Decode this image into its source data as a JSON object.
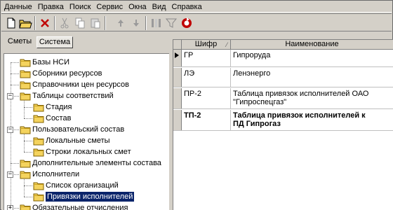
{
  "menu": [
    "Данные",
    "Правка",
    "Поиск",
    "Сервис",
    "Окна",
    "Вид",
    "Справка"
  ],
  "toolbar": {
    "buttons": [
      {
        "icon": "new-document-icon"
      },
      {
        "icon": "open-folder-icon"
      },
      {
        "icon": "delete-icon"
      },
      {
        "icon": "cut-icon"
      },
      {
        "icon": "copy-icon"
      },
      {
        "icon": "paste-icon"
      },
      {
        "icon": "move-up-icon"
      },
      {
        "icon": "move-down-icon"
      },
      {
        "icon": "columns-icon"
      },
      {
        "icon": "filter-icon"
      },
      {
        "icon": "refresh-icon"
      }
    ]
  },
  "tabs": {
    "smety": "Сметы",
    "sistema": "Система"
  },
  "tree": [
    {
      "label": "Базы НСИ",
      "level": 0,
      "expander": ""
    },
    {
      "label": "Сборники ресурсов",
      "level": 0,
      "expander": ""
    },
    {
      "label": "Справочники цен ресурсов",
      "level": 0,
      "expander": ""
    },
    {
      "label": "Таблицы соответствий",
      "level": 0,
      "expander": "−"
    },
    {
      "label": "Стадия",
      "level": 1,
      "expander": ""
    },
    {
      "label": "Состав",
      "level": 1,
      "expander": ""
    },
    {
      "label": "Пользовательский состав",
      "level": 0,
      "expander": "−"
    },
    {
      "label": "Локальные сметы",
      "level": 1,
      "expander": ""
    },
    {
      "label": "Строки локальных смет",
      "level": 1,
      "expander": ""
    },
    {
      "label": "Дополнительные элементы состава",
      "level": 0,
      "expander": ""
    },
    {
      "label": "Исполнители",
      "level": 0,
      "expander": "−"
    },
    {
      "label": "Список организаций",
      "level": 1,
      "expander": ""
    },
    {
      "label": "Привязки исполнителей",
      "level": 1,
      "expander": "",
      "selected": true
    },
    {
      "label": "Обязательные отчисления",
      "level": 0,
      "expander": "+"
    }
  ],
  "grid": {
    "col_code": "Шифр",
    "col_name": "Наименование",
    "sort_icon": "sort-indicator-icon",
    "rows": [
      {
        "code": "ГР",
        "name": "Гипроруда",
        "bold": false,
        "current": true
      },
      {
        "code": "ЛЭ",
        "name": "Ленэнерго",
        "bold": false,
        "current": false
      },
      {
        "code": "ПР-2",
        "name": "Таблица привязок исполнителей ОАО\n\"Гипроспецгаз\"",
        "bold": false,
        "current": false
      },
      {
        "code": "ТП-2",
        "name": "Таблица привязок исполнителей к\nПД Гипрогаз",
        "bold": true,
        "current": false
      }
    ]
  },
  "colors": {
    "face": "#d4d0c8",
    "selection": "#0a246a",
    "delete_red": "#c00000",
    "folder": "#f4d35e"
  }
}
